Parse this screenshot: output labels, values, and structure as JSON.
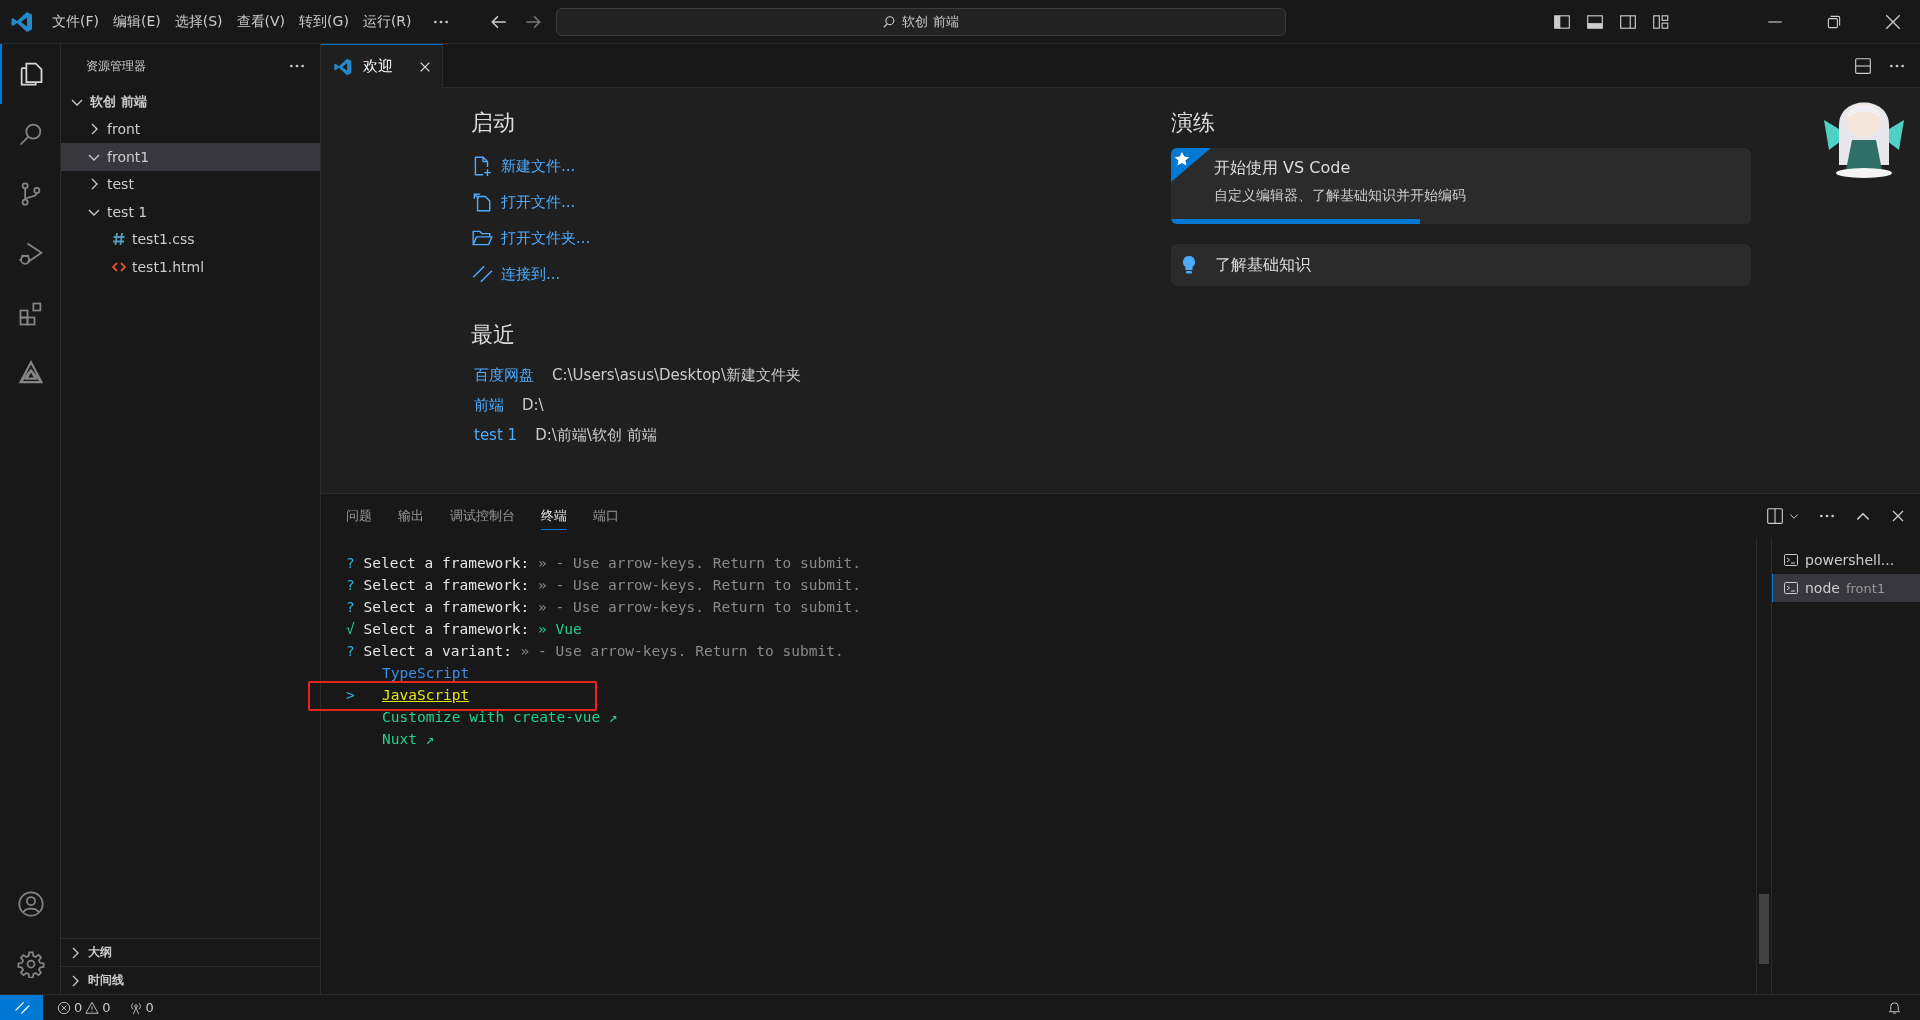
{
  "title_bar": {
    "menus": [
      "文件(F)",
      "编辑(E)",
      "选择(S)",
      "查看(V)",
      "转到(G)",
      "运行(R)"
    ],
    "search": "软创 前端"
  },
  "activity_bar": [
    {
      "kind": "explorer",
      "selected": true
    },
    {
      "kind": "search",
      "selected": false
    },
    {
      "kind": "source-control",
      "selected": false
    },
    {
      "kind": "run-debug",
      "selected": false
    },
    {
      "kind": "extensions",
      "selected": false
    },
    {
      "kind": "triangle-logo",
      "selected": false
    }
  ],
  "explorer": {
    "title": "资源管理器",
    "tree": [
      {
        "label": "软创 前端",
        "kind": "folder",
        "expanded": true,
        "selected": false,
        "children": [
          {
            "label": "front",
            "kind": "folder",
            "expanded": false,
            "selected": false
          },
          {
            "label": "front1",
            "kind": "folder",
            "expanded": true,
            "selected": true
          },
          {
            "label": "test",
            "kind": "folder",
            "expanded": false,
            "selected": false
          },
          {
            "label": "test 1",
            "kind": "folder",
            "expanded": true,
            "selected": false,
            "children": [
              {
                "label": "test1.css",
                "kind": "css",
                "selected": false
              },
              {
                "label": "test1.html",
                "kind": "html",
                "selected": false
              }
            ]
          }
        ]
      }
    ],
    "sections": [
      {
        "label": "大纲",
        "expanded": false
      },
      {
        "label": "时间线",
        "expanded": false
      }
    ]
  },
  "editor": {
    "tabs": [
      {
        "label": "欢迎",
        "selected": true
      }
    ],
    "start": {
      "heading": "启动",
      "actions": [
        {
          "label": "新建文件...",
          "kind": "new-file"
        },
        {
          "label": "打开文件...",
          "kind": "open-file"
        },
        {
          "label": "打开文件夹...",
          "kind": "open-folder"
        },
        {
          "label": "连接到...",
          "kind": "remote"
        }
      ]
    },
    "recent": {
      "heading": "最近",
      "items": [
        {
          "name": "百度网盘",
          "path": "C:\\Users\\asus\\Desktop\\新建文件夹"
        },
        {
          "name": "前端",
          "path": "D:\\"
        },
        {
          "name": "test 1",
          "path": "D:\\前端\\软创 前端"
        }
      ]
    },
    "walkthroughs": {
      "heading": "演练",
      "items": [
        {
          "kind": "featured",
          "title": "开始使用 VS Code",
          "description": "自定义编辑器、了解基础知识并开始编码",
          "level": 0.43
        },
        {
          "kind": "tip",
          "title": "了解基础知识"
        }
      ]
    }
  },
  "panel": {
    "tabs": [
      {
        "label": "问题",
        "selected": false
      },
      {
        "label": "输出",
        "selected": false
      },
      {
        "label": "调试控制台",
        "selected": false
      },
      {
        "label": "终端",
        "selected": true
      },
      {
        "label": "端口",
        "selected": false
      }
    ],
    "terminal": {
      "lines": [
        {
          "kind": "pending",
          "marker": "?",
          "question": "Select a framework:",
          "rest": "» - Use arrow-keys. Return to submit."
        },
        {
          "kind": "pending",
          "marker": "?",
          "question": "Select a framework:",
          "rest": "» - Use arrow-keys. Return to submit."
        },
        {
          "kind": "pending",
          "marker": "?",
          "question": "Select a framework:",
          "rest": "» - Use arrow-keys. Return to submit."
        },
        {
          "kind": "answered",
          "marker": "√",
          "question": "Select a framework:",
          "rest": "» Vue"
        },
        {
          "kind": "pending",
          "marker": "?",
          "question": "Select a variant:",
          "rest": "» - Use arrow-keys. Return to submit."
        }
      ],
      "pointer": ">",
      "options": [
        {
          "label": "TypeScript",
          "selected": false,
          "annotated": false,
          "color": "#3b8eea"
        },
        {
          "label": "JavaScript",
          "selected": true,
          "annotated": true,
          "color": "#e5e510"
        },
        {
          "label": "Customize with create-vue ↗",
          "selected": false,
          "annotated": false,
          "color": "#23d18b"
        },
        {
          "label": "Nuxt ↗",
          "selected": false,
          "annotated": false,
          "color": "#23d18b"
        }
      ]
    },
    "terminals": [
      {
        "name": "powershell...",
        "selected": false
      },
      {
        "name": "node",
        "detail": "front1",
        "selected": true
      }
    ]
  },
  "status_bar": {
    "errors": "0",
    "warnings": "0",
    "ports": "0"
  }
}
